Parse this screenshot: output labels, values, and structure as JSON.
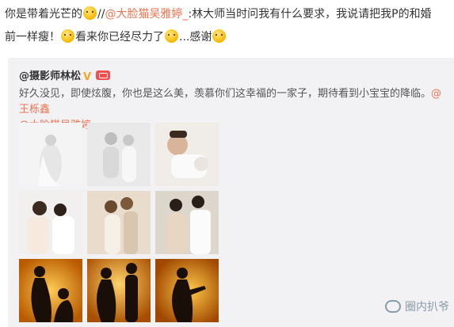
{
  "post": {
    "line1_before": "你是带着光芒的",
    "line1_sep": "//",
    "line1_mention": "@大脸猫吴雅婷_",
    "line1_after": ":林大师当时问我有什么要求，我说请把我P的和婚",
    "line2_before": "前一样瘦！",
    "line2_mid": "看来你已经尽力了",
    "line2_after": "...感谢",
    "emoji_names": [
      "shy-emoji",
      "smile-emoji",
      "laugh-cry-emoji",
      "wink-emoji"
    ]
  },
  "quote": {
    "author": "@摄影师林松",
    "text_before": "好久没见，即使炫腹，你也是这么美，羡慕你们这幸福的一家子，期待看到小宝宝的降临。",
    "mention1": "@王栎鑫",
    "mention2": "@大脸猫吴雅婷_"
  },
  "watermark": {
    "text": "圈内扒爷"
  },
  "colors": {
    "mention": "#eb7350",
    "quote_bg": "#f2f2f5",
    "badge": "#f5a623"
  }
}
